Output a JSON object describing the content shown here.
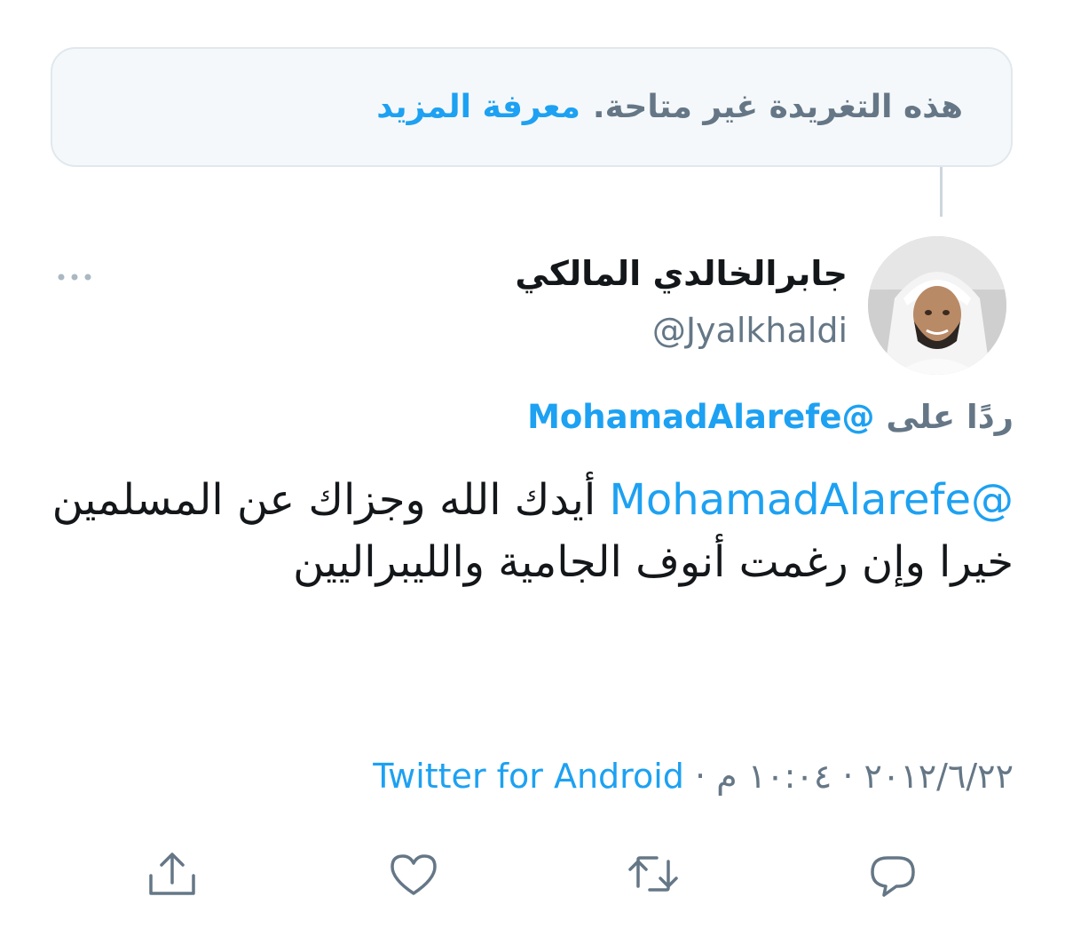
{
  "unavailable_notice": {
    "text": "هذه التغريدة غير متاحة.",
    "learn_more": "معرفة المزيد"
  },
  "tweet": {
    "author": {
      "display_name": "جابرالخالدي المالكي",
      "handle": "@Jyalkhaldi",
      "avatar_icon": "profile-photo"
    },
    "reply_to": {
      "prefix": "ردًا على",
      "handle": "@MohamadAlarefe"
    },
    "body": {
      "mention": "@MohamadAlarefe",
      "text": "أيدك الله وجزاك عن المسلمين خيرا وإن رغمت أنوف الجامية والليبراليين"
    },
    "meta": {
      "date": "٢٠١٢/٦/٢٢",
      "separator": "·",
      "time": "١٠:٠٤ م",
      "source": "Twitter for Android"
    }
  },
  "actions": [
    {
      "name": "reply",
      "icon": "speech-bubble-icon"
    },
    {
      "name": "retweet",
      "icon": "retweet-icon"
    },
    {
      "name": "like",
      "icon": "heart-icon"
    },
    {
      "name": "share",
      "icon": "share-icon"
    }
  ],
  "colors": {
    "accent": "#1da1f2",
    "secondary_text": "#657786",
    "primary_text": "#14171a",
    "border": "#e1e8ed",
    "notice_bg": "#f5f8fa"
  }
}
